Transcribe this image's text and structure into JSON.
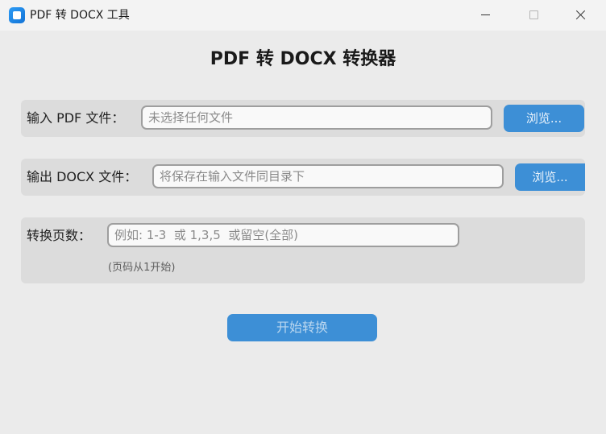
{
  "window": {
    "title": "PDF 转 DOCX 工具",
    "app_icon": "app-icon"
  },
  "main": {
    "heading": "PDF 转 DOCX 转换器",
    "input_row": {
      "label": "输入 PDF 文件：",
      "placeholder": "未选择任何文件",
      "value": "",
      "browse_label": "浏览..."
    },
    "output_row": {
      "label": "输出 DOCX 文件：",
      "placeholder": "将保存在输入文件同目录下",
      "value": "",
      "browse_label": "浏览..."
    },
    "pages_row": {
      "label": "转换页数：",
      "placeholder": "例如: 1-3  或 1,3,5  或留空(全部)",
      "value": "",
      "hint": "(页码从1开始)"
    },
    "start_label": "开始转换"
  },
  "colors": {
    "accent": "#3d8fd6",
    "background": "#ebebeb",
    "row_background": "#dcdcdc"
  }
}
